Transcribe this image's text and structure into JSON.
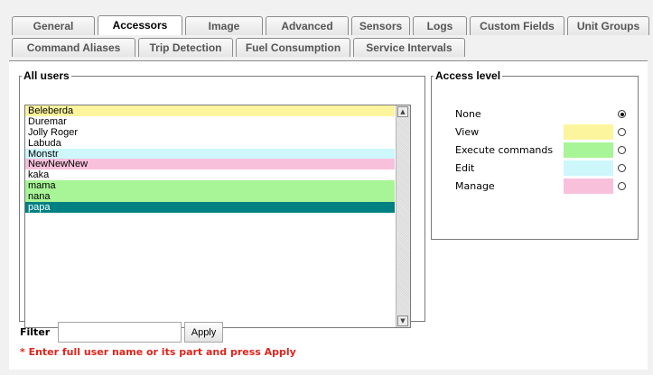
{
  "tabs": {
    "row1": [
      "General",
      "Accessors",
      "Image",
      "Advanced",
      "Sensors",
      "Logs",
      "Custom Fields",
      "Unit Groups"
    ],
    "row2": [
      "Command Aliases",
      "Trip Detection",
      "Fuel Consumption",
      "Service Intervals"
    ],
    "active": "Accessors"
  },
  "users_panel": {
    "legend": "All users",
    "users": [
      {
        "name": "Beleberda",
        "color": "#fcf59e"
      },
      {
        "name": "Duremar",
        "color": "#ffffff"
      },
      {
        "name": "Jolly Roger",
        "color": "#ffffff"
      },
      {
        "name": "Labuda",
        "color": "#ffffff"
      },
      {
        "name": "Monstr",
        "color": "#cdf7fb"
      },
      {
        "name": "NewNewNew",
        "color": "#f9c0dc"
      },
      {
        "name": "kaka",
        "color": "#ffffff"
      },
      {
        "name": "mama",
        "color": "#a7f596"
      },
      {
        "name": "nana",
        "color": "#a7f596"
      },
      {
        "name": "papa",
        "color": "#008080",
        "selected": true
      }
    ],
    "scroll_icons": {
      "up": "scroll-up-arrow-icon",
      "down": "scroll-down-arrow-icon"
    }
  },
  "access_panel": {
    "legend": "Access level",
    "levels": [
      {
        "label": "None",
        "color": "",
        "checked": true
      },
      {
        "label": "View",
        "color": "#fcf59e",
        "checked": false
      },
      {
        "label": "Execute commands",
        "color": "#a7f596",
        "checked": false
      },
      {
        "label": "Edit",
        "color": "#cdf7fb",
        "checked": false
      },
      {
        "label": "Manage",
        "color": "#f9c0dc",
        "checked": false
      }
    ]
  },
  "filter": {
    "label": "Filter",
    "value": "",
    "apply_label": "Apply",
    "hint": "* Enter full user name or its part and press Apply"
  },
  "colors": {
    "selected_row": "#008080",
    "hint_text": "#e0241c"
  }
}
